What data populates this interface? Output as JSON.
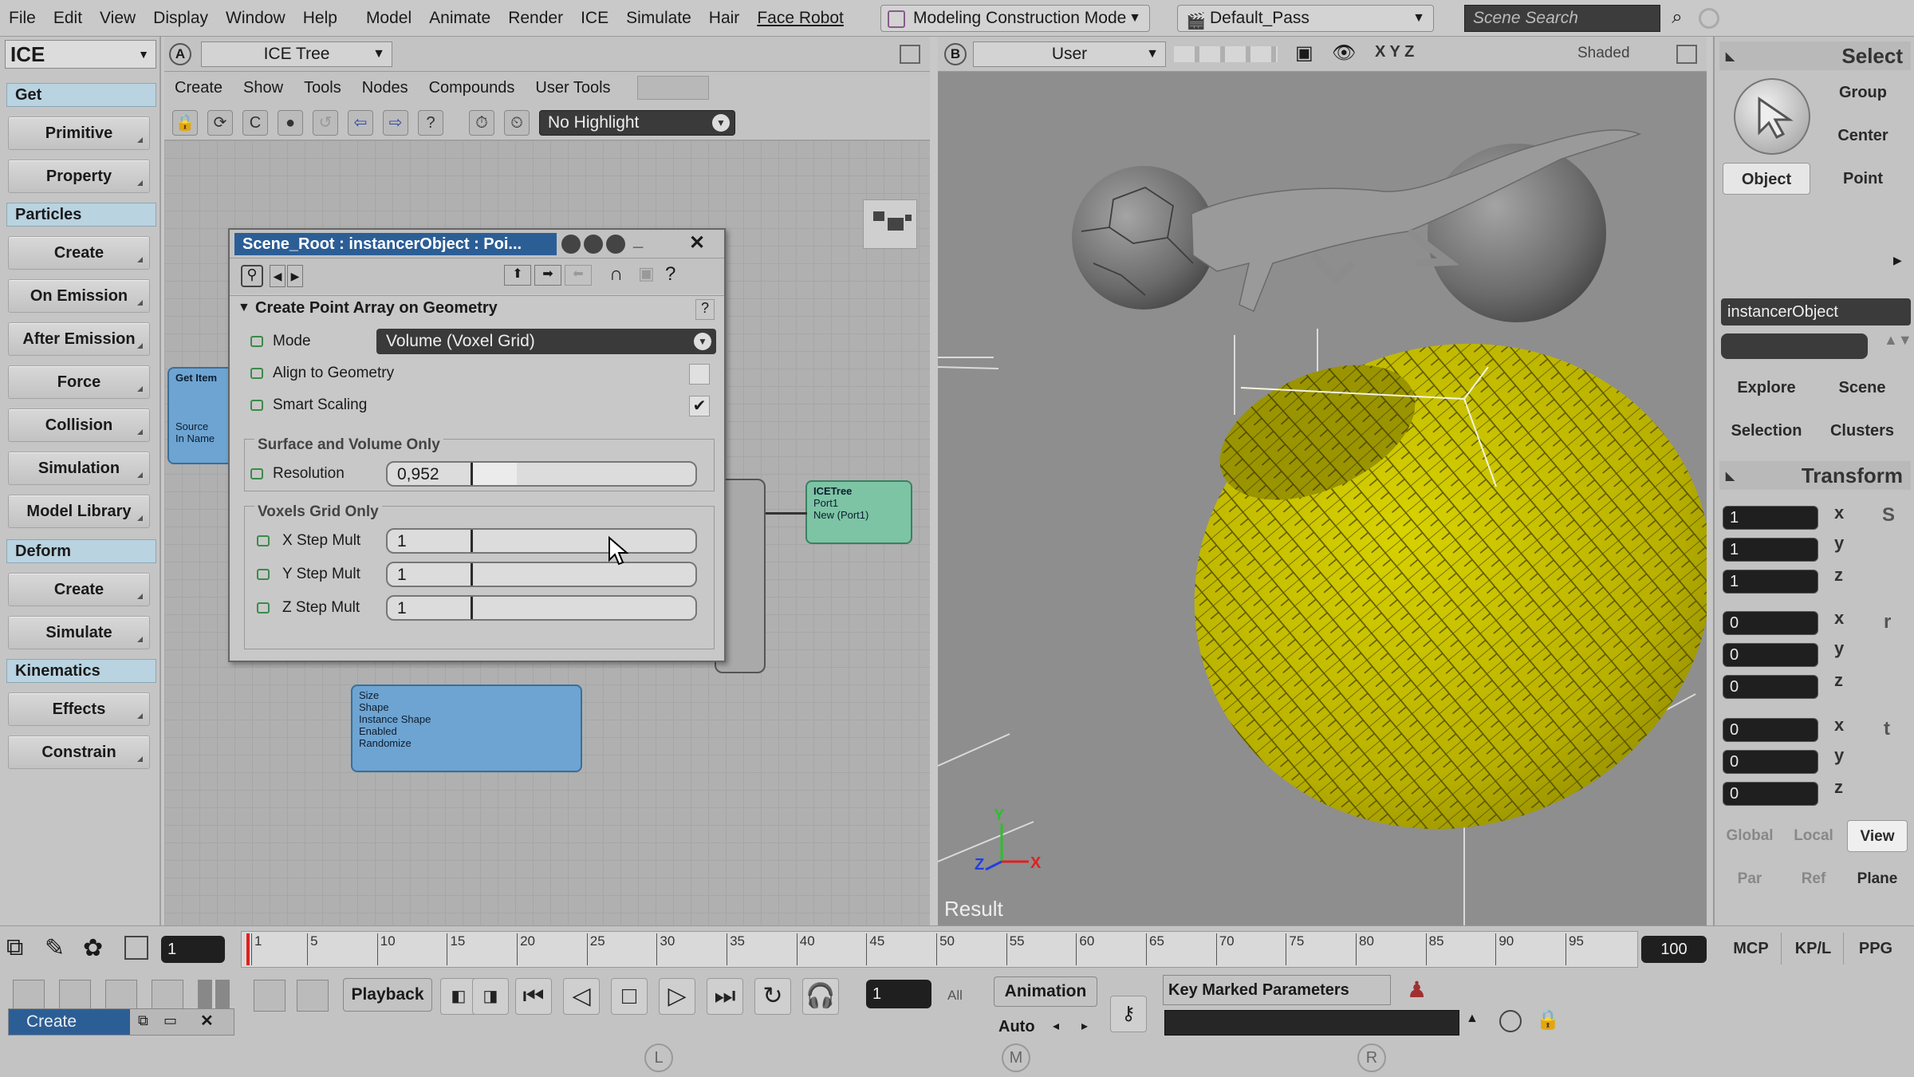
{
  "menubar": {
    "items": [
      "File",
      "Edit",
      "View",
      "Display",
      "Window",
      "Help",
      "Model",
      "Animate",
      "Render",
      "ICE",
      "Simulate",
      "Hair",
      "Face Robot"
    ],
    "mode": "Modeling Construction Mode",
    "pass": "Default_Pass",
    "search_placeholder": "Scene Search"
  },
  "left_panel": {
    "title": "ICE",
    "sections": {
      "get": "Get",
      "particles": "Particles",
      "deform": "Deform",
      "kinematics": "Kinematics"
    },
    "buttons": {
      "primitive": "Primitive",
      "property": "Property",
      "create1": "Create",
      "on_emission": "On Emission",
      "after_emission": "After Emission",
      "force": "Force",
      "collision": "Collision",
      "simulation": "Simulation",
      "model_library": "Model Library",
      "create2": "Create",
      "simulate": "Simulate",
      "effects": "Effects",
      "constrain": "Constrain"
    }
  },
  "ice_tree": {
    "view_label": "A",
    "view_name": "ICE Tree",
    "menu": [
      "Create",
      "Show",
      "Tools",
      "Nodes",
      "Compounds",
      "User Tools"
    ],
    "highlight": "No Highlight",
    "nodes": {
      "get_node_title": "Get Item",
      "get_node_ports": [
        "Source",
        "In Name"
      ],
      "icetree_title": "ICETree",
      "icetree_ports": [
        "Port1",
        "New (Port1)"
      ],
      "bottom_node_ports": [
        "Size",
        "Shape",
        "Instance Shape",
        "Enabled",
        "Randomize"
      ]
    }
  },
  "ppg": {
    "title": "Scene_Root : instancerObject : Poi...",
    "section": "Create Point Array on Geometry",
    "mode_label": "Mode",
    "mode_value": "Volume (Voxel Grid)",
    "align_label": "Align to Geometry",
    "align_checked": false,
    "smart_label": "Smart Scaling",
    "smart_checked": true,
    "group1": "Surface and Volume Only",
    "resolution_label": "Resolution",
    "resolution_value": "0,952",
    "group2": "Voxels Grid Only",
    "xstep_label": "X Step Mult",
    "xstep_value": "1",
    "ystep_label": "Y Step Mult",
    "ystep_value": "1",
    "zstep_label": "Z Step Mult",
    "zstep_value": "1"
  },
  "viewport": {
    "label": "B",
    "camera": "User",
    "axes": "X Y Z",
    "display_mode": "Shaded",
    "result_label": "Result",
    "torus_color": "#c8c100"
  },
  "right_panel": {
    "select_header": "Select",
    "buttons": {
      "group": "Group",
      "center": "Center",
      "object": "Object",
      "point": "Point",
      "explore": "Explore",
      "scene": "Scene",
      "selection": "Selection",
      "clusters": "Clusters"
    },
    "object_name": "instancerObject",
    "transform_header": "Transform",
    "scale": [
      "1",
      "1",
      "1"
    ],
    "rotate": [
      "0",
      "0",
      "0"
    ],
    "translate": [
      "0",
      "0",
      "0"
    ],
    "axis_labels": [
      "x",
      "y",
      "z"
    ],
    "transform_icons": [
      "S",
      "r",
      "t"
    ],
    "space_buttons": [
      "Global",
      "Local",
      "View"
    ],
    "ref_buttons": [
      "Par",
      "Ref",
      "Plane"
    ],
    "bottom_buttons": [
      "MCP",
      "KP/L",
      "PPG"
    ]
  },
  "timeline": {
    "current_frame": "1",
    "end_frame": "100",
    "ticks": [
      "1",
      "5",
      "10",
      "15",
      "20",
      "25",
      "30",
      "35",
      "40",
      "45",
      "50",
      "55",
      "60",
      "65",
      "70",
      "75",
      "80",
      "85",
      "90",
      "95"
    ]
  },
  "playback": {
    "label": "Playback",
    "frame": "1",
    "all_label": "All",
    "animation_label": "Animation",
    "auto_label": "Auto",
    "key_label": "Key Marked Parameters",
    "create_tab": "Create",
    "lmr": [
      "L",
      "M",
      "R"
    ]
  }
}
